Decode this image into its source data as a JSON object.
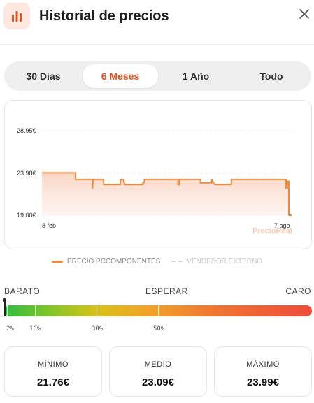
{
  "header": {
    "title": "Historial de precios",
    "icon": "bar-chart-icon",
    "close_icon": "close-icon",
    "accent": "#e0521d"
  },
  "tabs": [
    {
      "label": "30 Días",
      "active": false
    },
    {
      "label": "6 Meses",
      "active": true
    },
    {
      "label": "1 Año",
      "active": false
    },
    {
      "label": "Todo",
      "active": false
    }
  ],
  "chart_data": {
    "type": "line",
    "y_ticks": [
      "28.95€",
      "23.98€",
      "19.00€"
    ],
    "ylim": [
      19.0,
      28.95
    ],
    "x_tick_labels": [
      "8 feb",
      "7 ago"
    ],
    "watermark": "PrecioReal",
    "series": [
      {
        "name": "PRECIO PCCOMPONENTES",
        "color": "#f08a3a",
        "x": [
          0,
          48,
          48,
          72,
          72,
          73,
          74,
          88,
          88,
          112,
          112,
          116,
          118,
          144,
          144,
          146,
          146,
          194,
          194,
          196,
          196,
          226,
          226,
          242,
          242,
          246,
          248,
          270,
          270,
          348,
          348,
          350,
          350,
          352,
          352,
          356
        ],
        "values": [
          23.98,
          23.98,
          23.2,
          23.2,
          22.2,
          23.2,
          23.2,
          23.2,
          22.6,
          22.6,
          23.2,
          23.2,
          22.6,
          22.6,
          22.85,
          22.85,
          23.2,
          23.2,
          22.6,
          22.6,
          23.2,
          23.2,
          22.8,
          22.8,
          23.2,
          22.6,
          22.6,
          22.6,
          23.2,
          23.2,
          22.2,
          22.2,
          23.0,
          23.0,
          19.0,
          19.0
        ]
      },
      {
        "name": "VENDEDOR EXTERNO",
        "color": "#cfd6e0",
        "values": []
      }
    ],
    "grid": true
  },
  "legend": {
    "pc": "PRECIO PCCOMPONENTES",
    "ext": "VENDEDOR EXTERNO"
  },
  "scale": {
    "barato": "BARATO",
    "esperar": "ESPERAR",
    "caro": "CARO",
    "current_position_fraction": 0.0,
    "percent_labels": [
      "2%",
      "10%",
      "30%",
      "50%"
    ],
    "colors": [
      "#2ebc3e",
      "#7cc62a",
      "#d9c219",
      "#f3a12a",
      "#f07a30",
      "#ef4a3a"
    ]
  },
  "stats": [
    {
      "label": "MÍNIMO",
      "value": "21.76€"
    },
    {
      "label": "MEDIO",
      "value": "23.09€"
    },
    {
      "label": "MÁXIMO",
      "value": "23.99€"
    }
  ]
}
